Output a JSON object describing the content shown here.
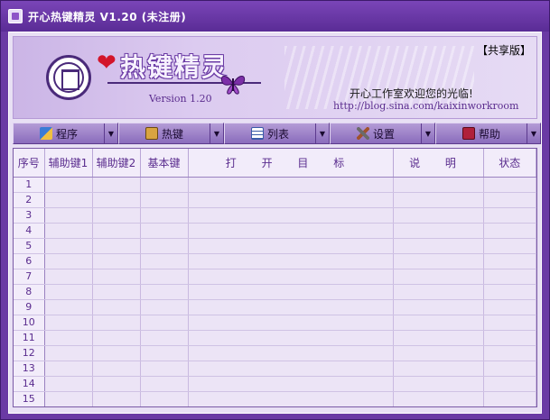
{
  "window": {
    "title": "开心热键精灵  V1.20  (未注册)"
  },
  "banner": {
    "logo_text": "热键精灵",
    "version": "Version 1.20",
    "share_badge": "【共享版】",
    "welcome": "开心工作室欢迎您的光临!",
    "url": "http://blog.sina.com/kaixinworkroom",
    "colors": {
      "heart": "#d3152a",
      "brand": "#5a2c8e"
    }
  },
  "toolbar": {
    "buttons": [
      {
        "label": "程序",
        "icon": "program-icon"
      },
      {
        "label": "热键",
        "icon": "hotkey-icon"
      },
      {
        "label": "列表",
        "icon": "list-icon"
      },
      {
        "label": "设置",
        "icon": "settings-icon"
      },
      {
        "label": "帮助",
        "icon": "help-book-icon"
      }
    ]
  },
  "table": {
    "headers": [
      "序号",
      "辅助键1",
      "辅助键2",
      "基本键",
      "打 开 目 标",
      "说 明",
      "状态"
    ],
    "rows": [
      "1",
      "2",
      "3",
      "4",
      "5",
      "6",
      "7",
      "8",
      "9",
      "10",
      "11",
      "12",
      "13",
      "14",
      "15"
    ]
  }
}
